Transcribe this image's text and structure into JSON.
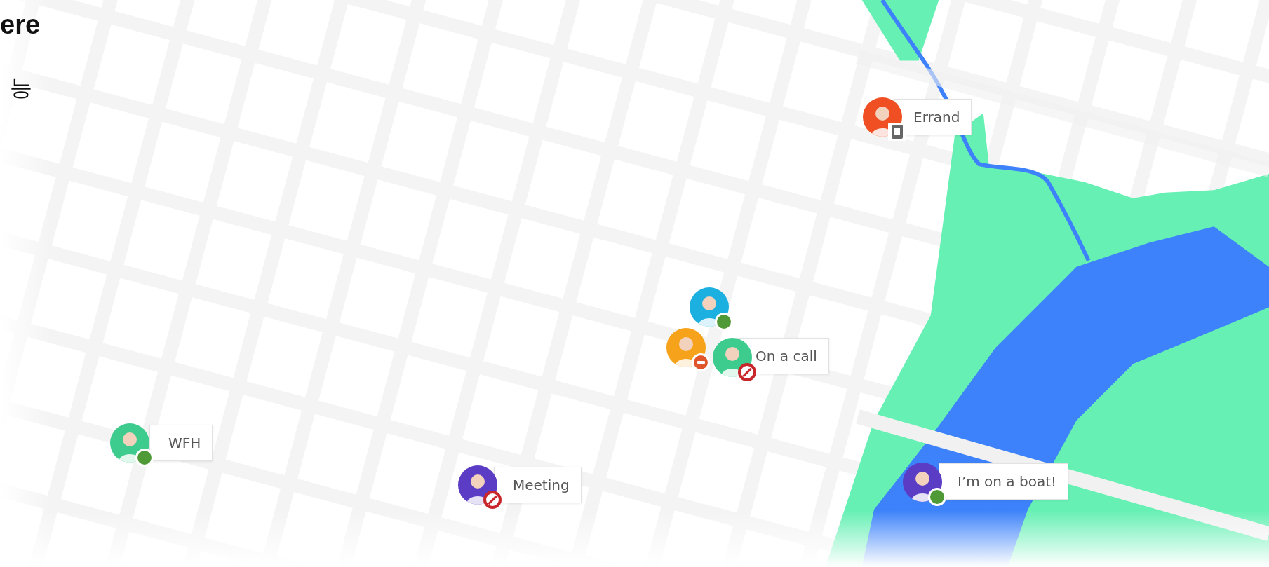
{
  "heading": "ere",
  "subheading": "능",
  "pins": [
    {
      "label": "Errand",
      "avatars": [
        {
          "color": "#f04e23",
          "kind": "mobile"
        }
      ]
    },
    {
      "label": "On a call",
      "avatars": [
        {
          "color": "#1cb0e0",
          "kind": "available"
        },
        {
          "color": "#f7a21b",
          "kind": "busy"
        },
        {
          "color": "#3dcc8e",
          "kind": "dnd"
        }
      ]
    },
    {
      "label": "WFH",
      "avatars": [
        {
          "color": "#3dcc8e",
          "kind": "available"
        }
      ]
    },
    {
      "label": "Meeting",
      "avatars": [
        {
          "color": "#5b3cc4",
          "kind": "dnd"
        }
      ]
    },
    {
      "label": "I’m on a boat!",
      "avatars": [
        {
          "color": "#5b3cc4",
          "kind": "available"
        }
      ]
    }
  ]
}
